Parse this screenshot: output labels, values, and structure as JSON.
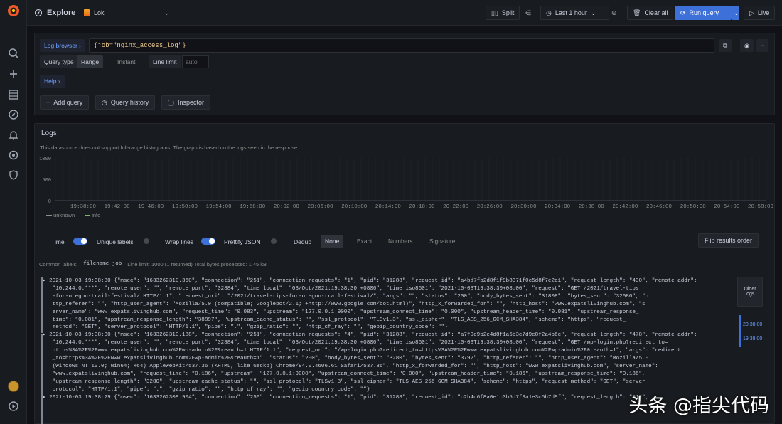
{
  "topbar": {
    "title": "Explore",
    "datasource": "Loki",
    "split": "Split",
    "time_range": "Last 1 hour",
    "clear_all": "Clear all",
    "run_query": "Run query",
    "live": "Live"
  },
  "query": {
    "label_browser": "Log browser",
    "expression": "{job=\"nginx_access_log\"}",
    "query_type_label": "Query type",
    "query_type_value": "Range",
    "instant": "Instant",
    "line_limit_label": "Line limit",
    "line_limit_placeholder": "auto",
    "query_letter": "Help"
  },
  "actions": {
    "add_query": "Add query",
    "query_history": "Query history",
    "inspector": "Inspector"
  },
  "logs": {
    "title": "Logs",
    "note": "This datasource does not support full-range histograms. The graph is based on the logs seen in the response.",
    "y_ticks": [
      "1000",
      "500",
      "0"
    ],
    "x_ticks": [
      "19:38:00",
      "19:40:00",
      "19:42:00",
      "19:44:00",
      "19:46:00",
      "19:48:00",
      "19:50:00",
      "19:52:00",
      "19:54:00",
      "19:56:00",
      "19:58:00",
      "20:00:00",
      "20:02:00",
      "20:04:00",
      "20:06:00",
      "20:08:00",
      "20:10:00",
      "20:12:00",
      "20:14:00",
      "20:16:00",
      "20:18:00",
      "20:20:00",
      "20:22:00",
      "20:24:00",
      "20:26:00",
      "20:28:00",
      "20:30:00",
      "20:32:00",
      "20:34:00",
      "20:36:00",
      "20:38:00",
      "20:40:00",
      "20:42:00",
      "20:44:00",
      "20:46:00",
      "20:48:00",
      "20:50:00",
      "20:52:00",
      "20:54:00",
      "20:56:00",
      "20:58:00"
    ],
    "legend": [
      "unknown",
      "info"
    ],
    "controls": {
      "time": "Time",
      "unique_labels": "Unique labels",
      "wrap_lines": "Wrap lines",
      "prettify": "Prettify JSON",
      "dedup": "Dedup",
      "none": "None",
      "exact": "Exact",
      "numbers": "Numbers",
      "signature": "Signature",
      "flip": "Flip results order"
    },
    "common_labels_title": "Common labels:",
    "common_labels": "filename  job",
    "summary": "Line limit: 1000 (1 returned)   Total bytes processed: 1.45 kB",
    "older": "Older logs",
    "lines": [
      "▸ 2021-10-03 19:38:30 {\"msec\": \"1633262310.360\", \"connection\": \"251\", \"connection_requests\": \"1\", \"pid\": \"31288\", \"request_id\": \"a4bd7fb2d8f1f9b8371f0c5d8f7e2a1\", \"request_length\": \"430\", \"remote_addr\":",
      "   \"10.244.0.***\", \"remote_user\": \"\", \"remote_port\": \"32884\", \"time_local\": \"03/Oct/2021:19:38:30 +0800\", \"time_iso8601\": \"2021-10-03T19:38:30+08:00\", \"request\": \"GET /2021/travel-tips",
      "   -for-oregon-trail-festival/ HTTP/1.1\", \"request_uri\": \"/2021/travel-tips-for-oregon-trail-festival/\", \"args\": \"\", \"status\": \"200\", \"body_bytes_sent\": \"31808\", \"bytes_sent\": \"32080\", \"h",
      "   ttp_referer\": \"\", \"http_user_agent\": \"Mozilla/5.0 (compatible; Googlebot/2.1; +http://www.google.com/bot.html)\", \"http_x_forwarded_for\": \"\", \"http_host\": \"www.expatslivinghub.com\", \"s",
      "   erver_name\": \"www.expatslivinghub.com\", \"request_time\": \"0.083\", \"upstream\": \"127.0.0.1:9000\", \"upstream_connect_time\": \"0.000\", \"upstream_header_time\": \"0.081\", \"upstream_response_",
      "   time\": \"0.081\", \"upstream_response_length\": \"38897\", \"upstream_cache_status\": \"\", \"ssl_protocol\": \"TLSv1.3\", \"ssl_cipher\": \"TLS_AES_256_GCM_SHA384\", \"scheme\": \"https\", \"request_",
      "   method\": \"GET\", \"server_protocol\": \"HTTP/1.1\", \"pipe\": \".\", \"gzip_ratio\": \"\", \"http_cf_ray\": \"\", \"geoip_country_code\": \"\"}",
      "▸ 2021-10-03 19:38:30 {\"msec\": \"1633262310.188\", \"connection\": \"251\", \"connection_requests\": \"4\", \"pid\": \"31288\", \"request_id\": \"a7f0c9b2e4d8f1a6b3c7d9e8f2a4b6c\", \"request_length\": \"478\", \"remote_addr\":",
      "   \"10.244.0.***\", \"remote_user\": \"\", \"remote_port\": \"32884\", \"time_local\": \"03/Oct/2021:19:38:30 +0800\", \"time_iso8601\": \"2021-10-03T19:38:30+08:00\", \"request\": \"GET /wp-login.php?redirect_to=",
      "   https%3A%2F%2Fwww.expatslivinghub.com%2Fwp-admin%2F&reauth=1 HTTP/1.1\", \"request_uri\": \"/wp-login.php?redirect_to=https%3A%2F%2Fwww.expatslivinghub.com%2Fwp-admin%2F&reauth=1\", \"args\": \"redirect",
      "   _to=https%3A%2F%2Fwww.expatslivinghub.com%2Fwp-admin%2F&reauth=1\", \"status\": \"200\", \"body_bytes_sent\": \"3280\", \"bytes_sent\": \"3792\", \"http_referer\": \"\", \"http_user_agent\": \"Mozilla/5.0",
      "   (Windows NT 10.0; Win64; x64) AppleWebKit/537.36 (KHTML, like Gecko) Chrome/94.0.4606.61 Safari/537.36\", \"http_x_forwarded_for\": \"\", \"http_host\": \"www.expatslivinghub.com\", \"server_name\":",
      "   \"www.expatslivinghub.com\", \"request_time\": \"0.186\", \"upstream\": \"127.0.0.1:9000\", \"upstream_connect_time\": \"0.000\", \"upstream_header_time\": \"0.186\", \"upstream_response_time\": \"0.186\",",
      "   \"upstream_response_length\": \"3280\", \"upstream_cache_status\": \"\", \"ssl_protocol\": \"TLSv1.3\", \"ssl_cipher\": \"TLS_AES_256_GCM_SHA384\", \"scheme\": \"https\", \"request_method\": \"GET\", \"server_",
      "   protocol\": \"HTTP/1.1\", \"pipe\": \".\", \"gzip_ratio\": \"\", \"http_cf_ray\": \"\", \"geoip_country_code\": \"\"}",
      "▸ 2021-10-03 19:38:29 {\"msec\": \"1633262309.904\", \"connection\": \"250\", \"connection_requests\": \"1\", \"pid\": \"31288\", \"request_id\": \"c2b4d6f8a0e1c3b5d7f9a1e3c5b7d9f\", \"request_length\": \"512\","
    ],
    "range_start": "19:38:00",
    "range_end": "20:38:00"
  },
  "watermark": "头条 @指尖代码",
  "chart_data": {
    "type": "bar",
    "title": "",
    "x_ticks": [
      "19:38:00",
      "19:40:00",
      "19:42:00",
      "19:44:00",
      "19:46:00",
      "19:48:00",
      "19:50:00",
      "19:52:00",
      "19:54:00",
      "19:56:00",
      "19:58:00",
      "20:00:00",
      "20:02:00",
      "20:04:00",
      "20:06:00",
      "20:08:00",
      "20:10:00",
      "20:12:00",
      "20:14:00",
      "20:16:00",
      "20:18:00",
      "20:20:00",
      "20:22:00",
      "20:24:00",
      "20:26:00",
      "20:28:00",
      "20:30:00",
      "20:32:00",
      "20:34:00",
      "20:36:00",
      "20:38:00",
      "20:40:00",
      "20:42:00",
      "20:44:00",
      "20:46:00",
      "20:48:00",
      "20:50:00",
      "20:52:00",
      "20:54:00",
      "20:56:00",
      "20:58:00"
    ],
    "ylim": [
      0,
      1000
    ],
    "series": [
      {
        "name": "unknown",
        "values": []
      },
      {
        "name": "info",
        "values": []
      }
    ],
    "legend_position": "bottom-left"
  }
}
